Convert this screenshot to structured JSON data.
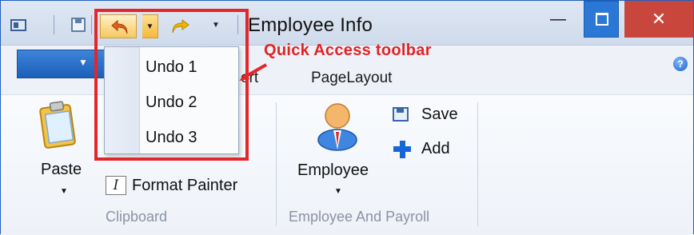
{
  "window": {
    "title": "Employee Info",
    "minimize_glyph": "—",
    "close_glyph": "✕"
  },
  "quick_access_toolbar": {
    "icons": [
      "app-icon",
      "save-icon",
      "undo-icon",
      "redo-icon",
      "customize-icon"
    ],
    "undo_dropdown": {
      "items": [
        "Undo 1",
        "Undo 2",
        "Undo 3"
      ]
    }
  },
  "annotation": {
    "text": "Quick Access toolbar",
    "color": "#e3262a"
  },
  "ribbon": {
    "tabs": [
      "ert",
      "PageLayout"
    ],
    "help_glyph": "?",
    "groups": [
      {
        "label": "Clipboard",
        "buttons": [
          {
            "label": "Paste",
            "icon": "clipboard-icon"
          },
          {
            "label": "Format Painter",
            "icon": "format-painter-icon",
            "icon_glyph": "I"
          }
        ]
      },
      {
        "label": "Employee And Payroll",
        "buttons": [
          {
            "label": "Employee",
            "icon": "employee-icon"
          },
          {
            "label": "Save",
            "icon": "save-icon"
          },
          {
            "label": "Add",
            "icon": "add-icon"
          }
        ]
      }
    ]
  },
  "colors": {
    "title_bar": "#cfdbec",
    "accent_blue": "#2b77d6",
    "close_red": "#c9463d",
    "highlight_red": "#e3262a"
  }
}
